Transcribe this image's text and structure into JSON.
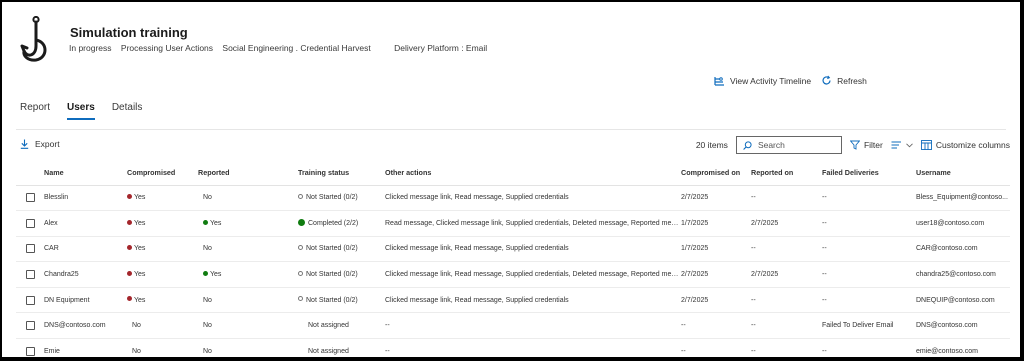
{
  "header": {
    "title": "Simulation training",
    "meta": [
      "In progress",
      "Processing User Actions",
      "Social Engineering . Credential Harvest",
      "Delivery Platform : Email"
    ]
  },
  "actions": {
    "timeline_label": "View Activity Timeline",
    "refresh_label": "Refresh"
  },
  "tabs": [
    {
      "label": "Report",
      "active": false
    },
    {
      "label": "Users",
      "active": true
    },
    {
      "label": "Details",
      "active": false
    }
  ],
  "toolbar": {
    "export_label": "Export",
    "items_count": "20 items",
    "search_placeholder": "Search",
    "filter_label": "Filter",
    "customize_label": "Customize columns"
  },
  "table": {
    "columns": [
      "Name",
      "Compromised",
      "Reported",
      "Training status",
      "Other actions",
      "Compromised on",
      "Reported on",
      "Failed Deliveries",
      "Username"
    ],
    "rows": [
      {
        "name": "Blesslin",
        "compromised": "Yes",
        "compromised_flag": "red",
        "reported": "No",
        "reported_flag": "",
        "training": "Not Started (0/2)",
        "training_icon": "ring",
        "other": "Clicked message link, Read message, Supplied credentials",
        "compromised_on": "2/7/2025",
        "reported_on": "--",
        "failed": "--",
        "username": "Bless_Equipment@contoso..."
      },
      {
        "name": "Alex",
        "compromised": "Yes",
        "compromised_flag": "red",
        "reported": "Yes",
        "reported_flag": "green",
        "training": "Completed (2/2)",
        "training_icon": "check",
        "other": "Read message, Clicked message link, Supplied credentials, Deleted message, Reported mess...",
        "compromised_on": "1/7/2025",
        "reported_on": "2/7/2025",
        "failed": "--",
        "username": "user18@contoso.com"
      },
      {
        "name": "CAR",
        "compromised": "Yes",
        "compromised_flag": "red",
        "reported": "No",
        "reported_flag": "",
        "training": "Not Started (0/2)",
        "training_icon": "ring",
        "other": "Clicked message link, Read message, Supplied credentials",
        "compromised_on": "1/7/2025",
        "reported_on": "--",
        "failed": "--",
        "username": "CAR@contoso.com"
      },
      {
        "name": "Chandra25",
        "compromised": "Yes",
        "compromised_flag": "red",
        "reported": "Yes",
        "reported_flag": "green",
        "training": "Not Started (0/2)",
        "training_icon": "ring",
        "other": "Clicked message link, Read message, Supplied credentials, Deleted message, Reported mess...",
        "compromised_on": "2/7/2025",
        "reported_on": "2/7/2025",
        "failed": "--",
        "username": "chandra25@contoso.com"
      },
      {
        "name": "DN Equipment",
        "compromised": "Yes",
        "compromised_flag": "red",
        "reported": "No",
        "reported_flag": "",
        "training": "Not Started (0/2)",
        "training_icon": "ring",
        "other": "Clicked message link, Read message, Supplied credentials",
        "compromised_on": "2/7/2025",
        "reported_on": "--",
        "failed": "--",
        "username": "DNEQUIP@contoso.com"
      },
      {
        "name": "DNS@contoso.com",
        "compromised": "No",
        "compromised_flag": "",
        "reported": "No",
        "reported_flag": "",
        "training": "Not assigned",
        "training_icon": "",
        "other": "--",
        "compromised_on": "--",
        "reported_on": "--",
        "failed": "Failed To Deliver Email",
        "username": "DNS@contoso.com"
      },
      {
        "name": "Emie",
        "compromised": "No",
        "compromised_flag": "",
        "reported": "No",
        "reported_flag": "",
        "training": "Not assigned",
        "training_icon": "",
        "other": "--",
        "compromised_on": "--",
        "reported_on": "--",
        "failed": "--",
        "username": "emie@contoso.com"
      }
    ]
  }
}
